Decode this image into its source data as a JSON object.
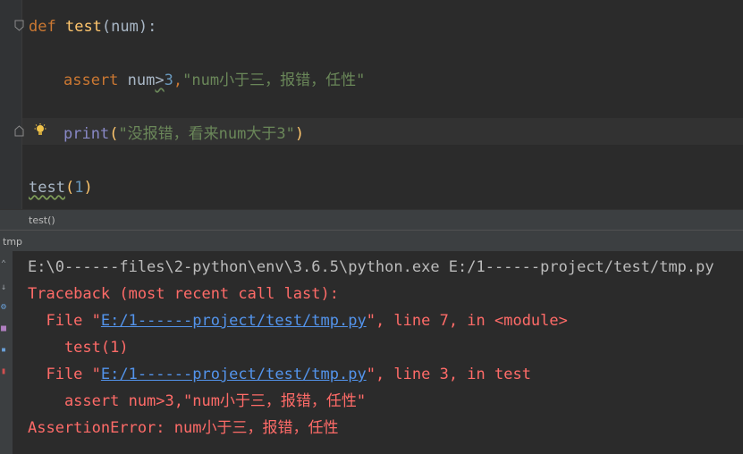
{
  "editor": {
    "line1": {
      "kw": "def",
      "fn": "test",
      "open": "(",
      "param": "num",
      "close": "):"
    },
    "line2": {
      "kw": "assert",
      "lhs": "num",
      "op": ">",
      "num": "3",
      "comma": ",",
      "str": "\"num小于三，报错，任性\""
    },
    "line3": {
      "builtin": "print",
      "open": "(",
      "str": "\"没报错，看来num大于3\"",
      "close": ")"
    },
    "line4": {
      "fn": "test",
      "open": "(",
      "num": "1",
      "close": ")"
    }
  },
  "breadcrumb": {
    "label": "test()"
  },
  "run_tab": {
    "label": "tmp"
  },
  "console": {
    "cmd": "E:\\0------files\\2-python\\env\\3.6.5\\python.exe E:/1------project/test/tmp.py",
    "traceback_header": "Traceback (most recent call last):",
    "frame1": {
      "prefix": "  File \"",
      "path": "E:/1------project/test/tmp.py",
      "suffix": "\", line 7, in <module>"
    },
    "frame1_code": "    test(1)",
    "frame2": {
      "prefix": "  File \"",
      "path": "E:/1------project/test/tmp.py",
      "suffix": "\", line 3, in test"
    },
    "frame2_code": "    assert num>3,\"num小于三，报错，任性\"",
    "error": "AssertionError: num小于三，报错，任性"
  },
  "colors": {
    "background": "#2b2b2b",
    "keyword": "#cc7832",
    "function": "#ffc66d",
    "number": "#6897bb",
    "string": "#6a8759",
    "error": "#ff6b68",
    "link": "#5394ec"
  }
}
